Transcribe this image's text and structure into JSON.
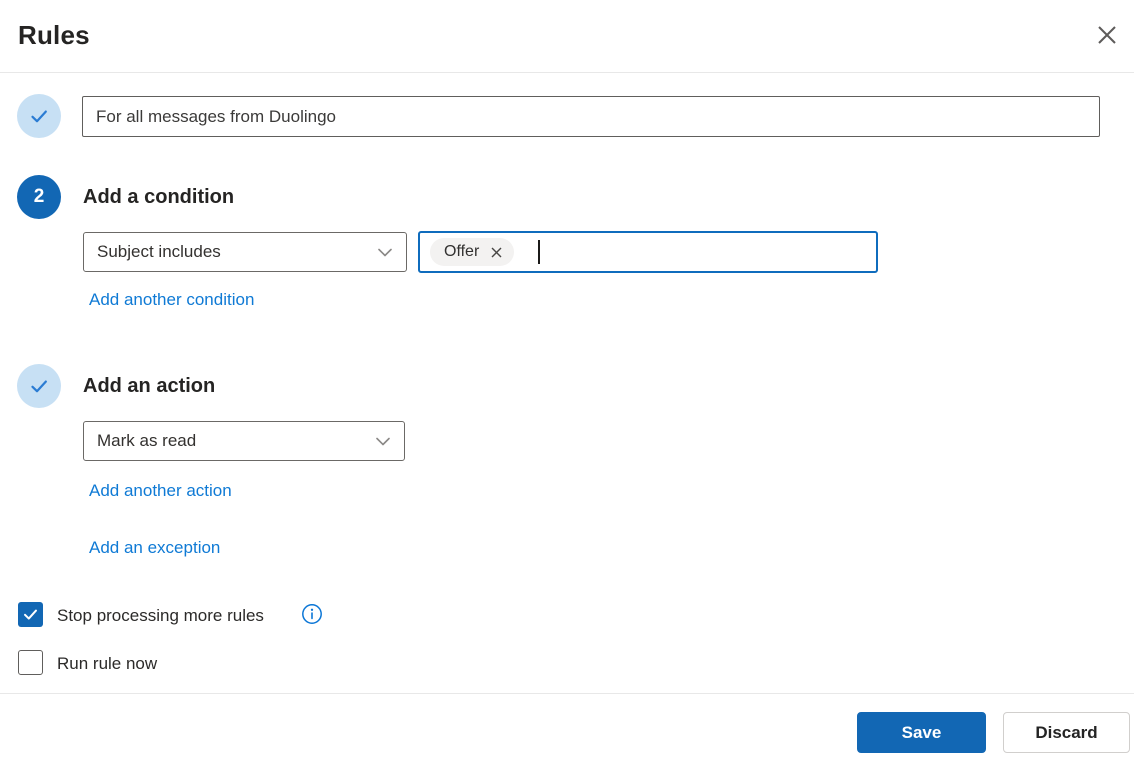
{
  "dialog": {
    "title": "Rules"
  },
  "rule_name_step": {
    "state": "complete",
    "value": "For all messages from Duolingo"
  },
  "condition_step": {
    "step_number": "2",
    "heading": "Add a condition",
    "condition_dropdown": {
      "selected": "Subject includes"
    },
    "chips": [
      {
        "label": "Offer"
      }
    ],
    "add_link": "Add another condition"
  },
  "action_step": {
    "state": "complete",
    "heading": "Add an action",
    "action_dropdown": {
      "selected": "Mark as read"
    },
    "add_link": "Add another action",
    "exception_link": "Add an exception"
  },
  "options": {
    "stop_processing": {
      "label": "Stop processing more rules",
      "checked": true
    },
    "run_now": {
      "label": "Run rule now",
      "checked": false
    }
  },
  "footer": {
    "save_label": "Save",
    "discard_label": "Discard"
  },
  "icons": {
    "close": "✕",
    "checkmark": "✓",
    "chevron_down": "⌄",
    "chip_dismiss": "✕",
    "info": "ⓘ"
  },
  "colors": {
    "accent": "#1267b4",
    "focus_border": "#0f6cbd",
    "link": "#0f7ad5",
    "step_complete_bg": "#c7e0f4",
    "step_check": "#2b7cd3",
    "input_border": "#605e5c",
    "chip_bg": "#f3f2f1",
    "divider": "#e8e8e8"
  }
}
